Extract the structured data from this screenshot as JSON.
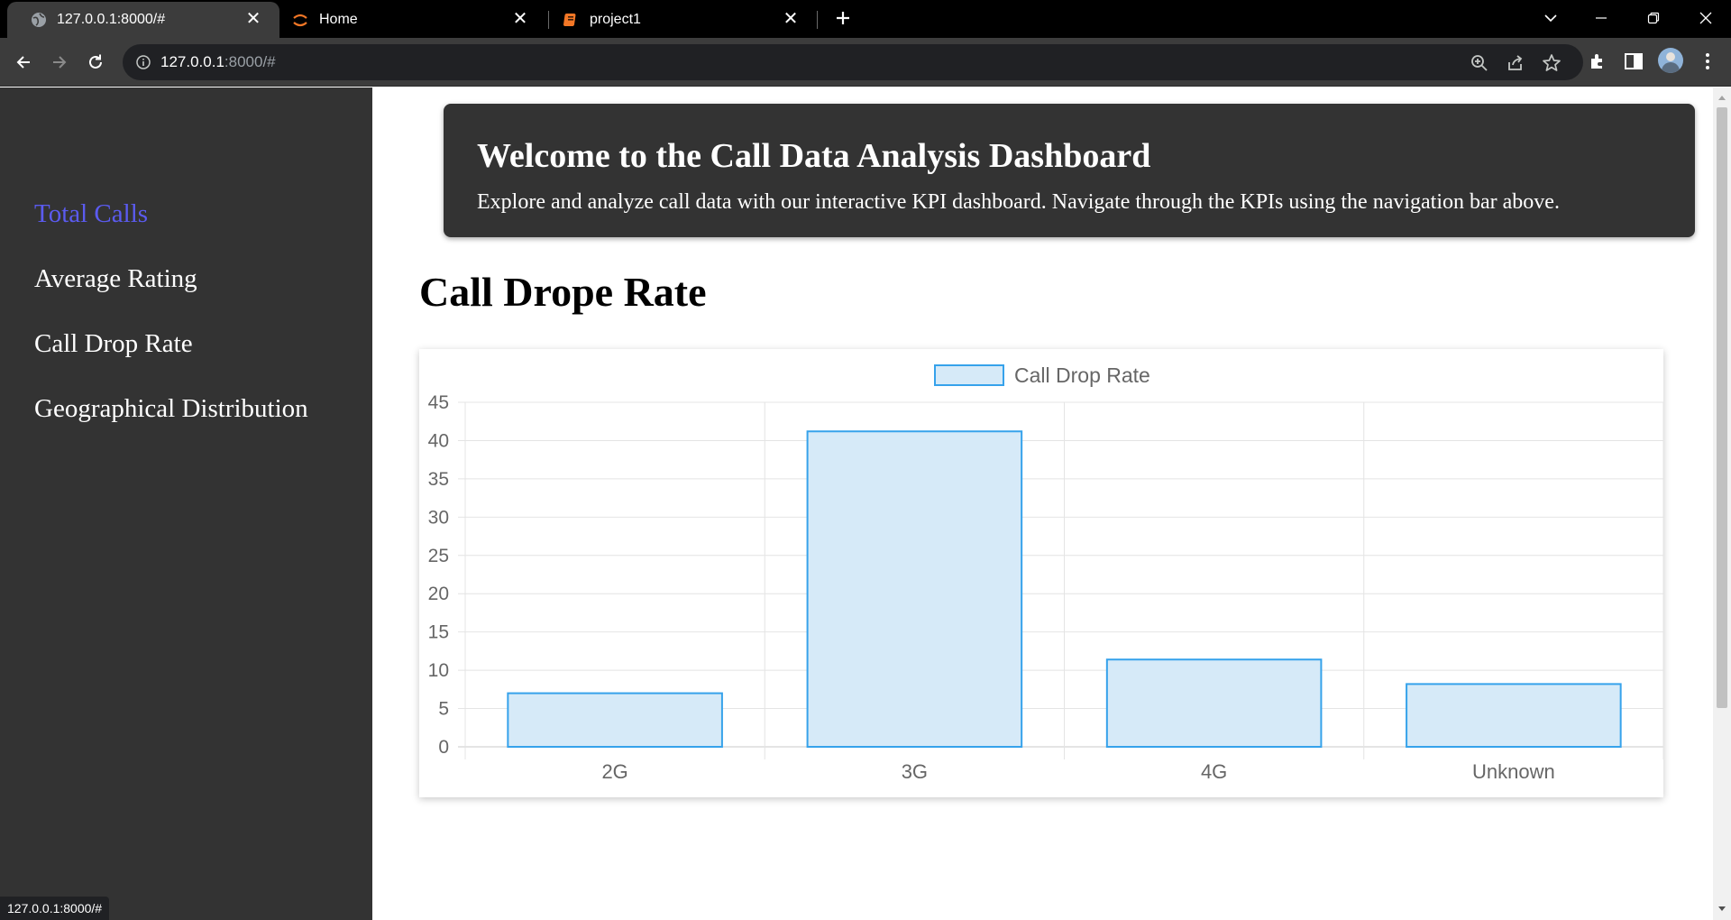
{
  "browser": {
    "tabs": [
      {
        "title": "127.0.0.1:8000/#",
        "icon": "globe-icon",
        "active": true
      },
      {
        "title": "Home",
        "icon": "jupyter-icon",
        "active": false
      },
      {
        "title": "project1",
        "icon": "notebook-icon",
        "active": false
      }
    ],
    "url_host": "127.0.0.1",
    "url_path": ":8000/#",
    "status_url": "127.0.0.1:8000/#"
  },
  "sidebar": {
    "items": [
      {
        "label": "Total Calls",
        "active": true
      },
      {
        "label": "Average Rating",
        "active": false
      },
      {
        "label": "Call Drop Rate",
        "active": false
      },
      {
        "label": "Geographical Distribution",
        "active": false
      }
    ],
    "active_color": "#5b5bf0"
  },
  "hero": {
    "title": "Welcome to the Call Data Analysis Dashboard",
    "subtitle": "Explore and analyze call data with our interactive KPI dashboard. Navigate through the KPIs using the navigation bar above."
  },
  "section": {
    "title": "Call Drope Rate"
  },
  "chart_data": {
    "type": "bar",
    "categories": [
      "2G",
      "3G",
      "4G",
      "Unknown"
    ],
    "series": [
      {
        "name": "Call Drop Rate",
        "values": [
          7.0,
          41.2,
          11.4,
          8.2
        ]
      }
    ],
    "ylim": [
      0,
      45
    ],
    "yticks": [
      0,
      5,
      10,
      15,
      20,
      25,
      30,
      35,
      40,
      45
    ],
    "grid": true,
    "legend": "top-center",
    "bar_fill": "#d6eaf8",
    "bar_stroke": "#36a2eb"
  }
}
